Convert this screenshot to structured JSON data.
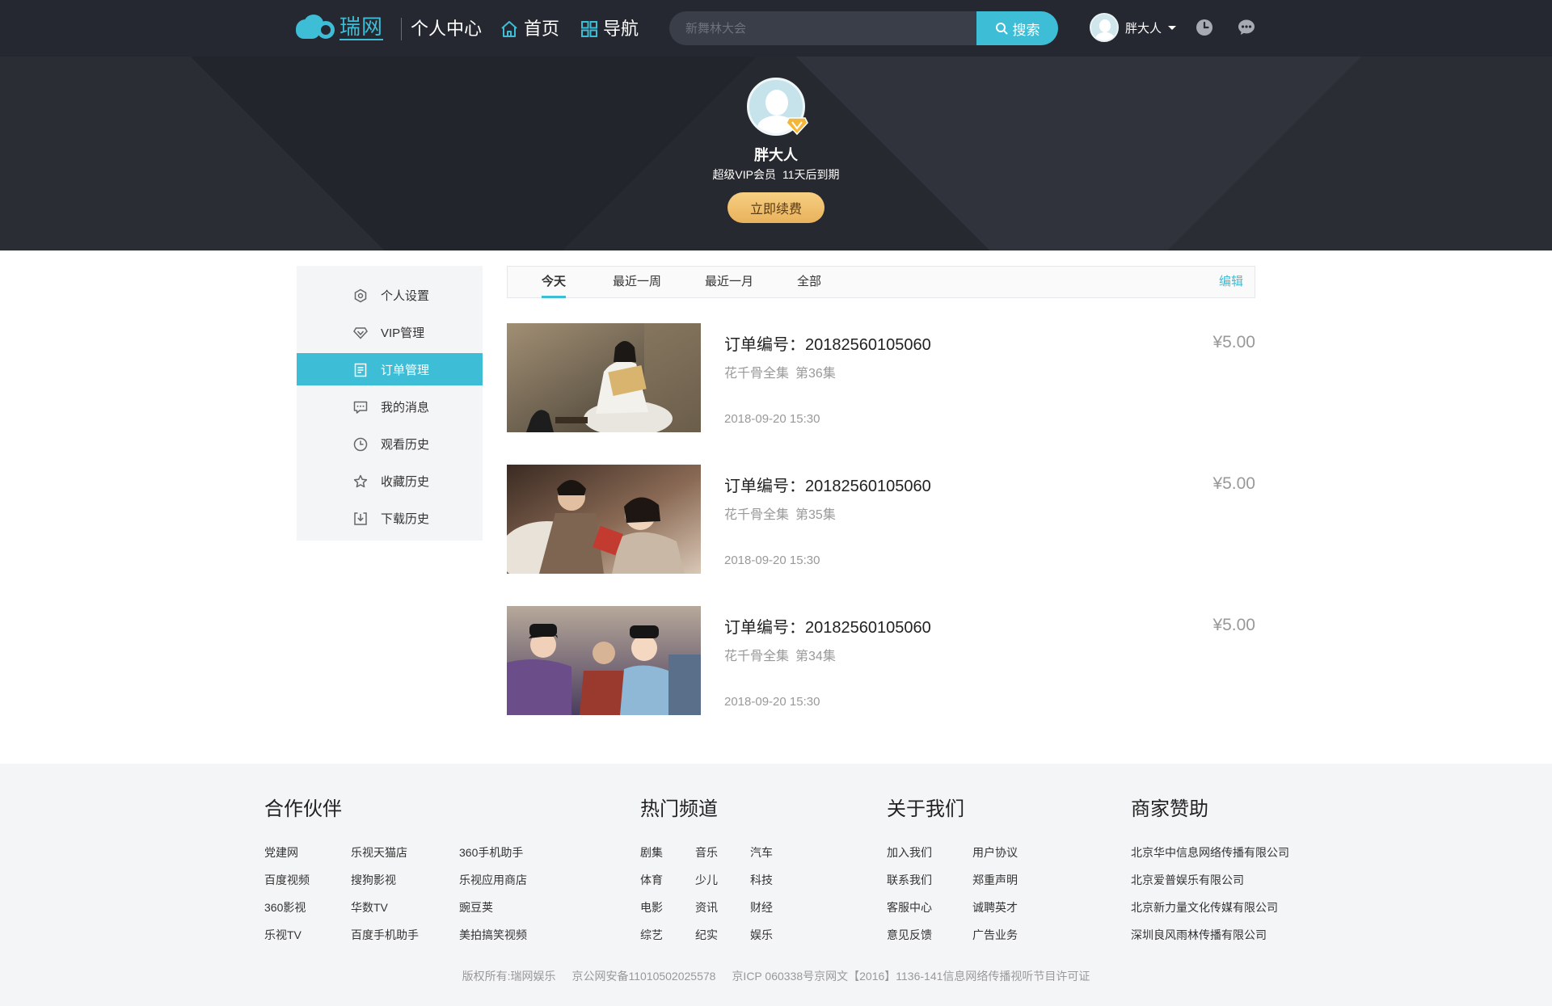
{
  "header": {
    "logo_text": "瑞网",
    "section_title": "个人中心",
    "nav": [
      {
        "label": "首页",
        "icon": "home-icon"
      },
      {
        "label": "导航",
        "icon": "grid-icon"
      }
    ],
    "search": {
      "placeholder": "新舞林大会",
      "button_label": "搜索"
    },
    "user_name": "胖大人"
  },
  "profile": {
    "name": "胖大人",
    "vip_level": "超级VIP会员",
    "expiry": "11天后到期",
    "renew_label": "立即续费"
  },
  "sidebar": {
    "items": [
      {
        "label": "个人设置",
        "icon": "settings-icon",
        "active": false
      },
      {
        "label": "VIP管理",
        "icon": "diamond-icon",
        "active": false
      },
      {
        "label": "订单管理",
        "icon": "order-icon",
        "active": true
      },
      {
        "label": "我的消息",
        "icon": "message-icon",
        "active": false
      },
      {
        "label": "观看历史",
        "icon": "clock-icon",
        "active": false
      },
      {
        "label": "收藏历史",
        "icon": "star-icon",
        "active": false
      },
      {
        "label": "下载历史",
        "icon": "download-icon",
        "active": false
      }
    ]
  },
  "tabs": {
    "items": [
      "今天",
      "最近一周",
      "最近一月",
      "全部"
    ],
    "active": "今天",
    "edit_label": "编辑"
  },
  "orders": [
    {
      "number": "订单编号：20182560105060",
      "series": "花千骨全集",
      "episode": "第36集",
      "time": "2018-09-20 15:30",
      "price": "¥5.00"
    },
    {
      "number": "订单编号：20182560105060",
      "series": "花千骨全集",
      "episode": "第35集",
      "time": "2018-09-20 15:30",
      "price": "¥5.00"
    },
    {
      "number": "订单编号：20182560105060",
      "series": "花千骨全集",
      "episode": "第34集",
      "time": "2018-09-20 15:30",
      "price": "¥5.00"
    }
  ],
  "footer": {
    "partners": {
      "title": "合作伙伴",
      "links": [
        "党建网",
        "乐视天猫店",
        "360手机助手",
        "百度视频",
        "搜狗影视",
        "乐视应用商店",
        "360影视",
        "华数TV",
        "豌豆荚",
        "乐视TV",
        "百度手机助手",
        "美拍搞笑视频"
      ]
    },
    "hot_channels": {
      "title": "热门频道",
      "links": [
        "剧集",
        "音乐",
        "汽车",
        "体育",
        "少儿",
        "科技",
        "电影",
        "资讯",
        "财经",
        "综艺",
        "纪实",
        "娱乐"
      ]
    },
    "about": {
      "title": "关于我们",
      "links": [
        "加入我们",
        "用户协议",
        "联系我们",
        "郑重声明",
        "客服中心",
        "诚聘英才",
        "意见反馈",
        "广告业务"
      ]
    },
    "sponsors": {
      "title": "商家赞助",
      "links": [
        "北京华中信息网络传播有限公司",
        "北京爱普娱乐有限公司",
        "北京新力量文化传媒有限公司",
        "深圳良风雨林传播有限公司"
      ]
    },
    "copyright": {
      "owner": "版权所有:瑞网娱乐",
      "police": "京公网安备11010502025578",
      "icp": "京ICP 060338号京网文【2016】1136-141信息网络传播视听节目许可证"
    }
  },
  "colors": {
    "accent": "#3dbdd6",
    "topbar": "#252830",
    "banner": "#2a2d34",
    "renew_gold": "#e9b25c"
  }
}
